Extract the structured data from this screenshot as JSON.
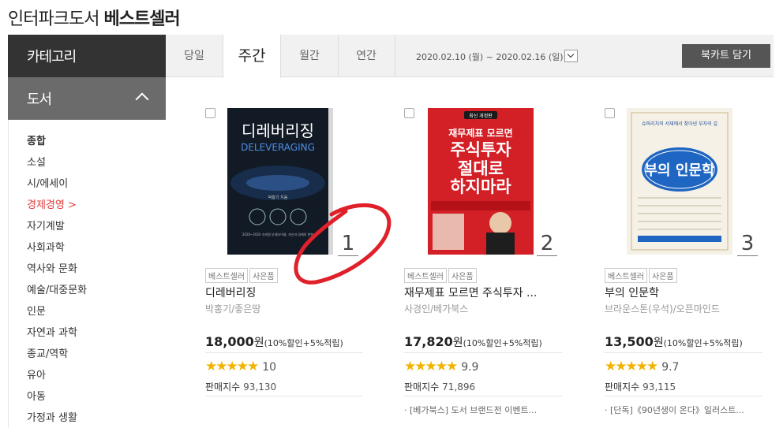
{
  "header": {
    "title_prefix": "인터파크도서",
    "title_main": "베스트셀러"
  },
  "sidebar": {
    "category_label": "카테고리",
    "section_label": "도서",
    "items": [
      {
        "label": "종합"
      },
      {
        "label": "소설"
      },
      {
        "label": "시/에세이"
      },
      {
        "label": "경제경영 >"
      },
      {
        "label": "자기계발"
      },
      {
        "label": "사회과학"
      },
      {
        "label": "역사와 문화"
      },
      {
        "label": "예술/대중문화"
      },
      {
        "label": "인문"
      },
      {
        "label": "자연과 과학"
      },
      {
        "label": "종교/역학"
      },
      {
        "label": "유아"
      },
      {
        "label": "아동"
      },
      {
        "label": "가정과 생활"
      }
    ]
  },
  "tabs": {
    "items": [
      {
        "label": "당일"
      },
      {
        "label": "주간"
      },
      {
        "label": "월간"
      },
      {
        "label": "연간"
      }
    ],
    "date_range": "2020.02.10 (월) ~ 2020.02.16 (일)",
    "cart_button": "북카트 담기"
  },
  "books": [
    {
      "rank": "1",
      "badges": [
        "베스트셀러",
        "사은품"
      ],
      "title": "디레버리징",
      "author": "박홍기/좋은땅",
      "price": "18,000",
      "won": "원",
      "discount": "(10%할인+5%적립)",
      "stars": "★★★★★",
      "score": "10",
      "sales_label": "판매지수",
      "sales_value": "93,130",
      "promo": "",
      "cover": {
        "title_ko": "디레버리징",
        "title_en": "DELEVERAGING",
        "author": "박홍기 지음",
        "years": "2020~2024 슈퍼원 부채사이클, 자산과 경제의 변화"
      }
    },
    {
      "rank": "2",
      "badges": [
        "베스트셀러",
        "사은품"
      ],
      "title": "재무제표 모르면 주식투자 ...",
      "author": "사경인/베가북스",
      "price": "17,820",
      "won": "원",
      "discount": "(10%할인+5%적립)",
      "stars": "★★★★★",
      "score": "9.9",
      "sales_label": "판매지수",
      "sales_value": "71,896",
      "promo": "· [베가북스] 도서 브랜드전 이벤트...",
      "cover": {
        "tag": "최신 개정판",
        "line1": "재무제표 모르면",
        "line2": "주식투자",
        "line3": "절대로",
        "line4": "하지마라"
      }
    },
    {
      "rank": "3",
      "badges": [
        "베스트셀러",
        "사은품"
      ],
      "title": "부의 인문학",
      "author": "브라운스톤(우석)/오픈마인드",
      "price": "13,500",
      "won": "원",
      "discount": "(10%할인+5%적립)",
      "stars": "★★★★★",
      "score": "9.7",
      "sales_label": "판매지수",
      "sales_value": "93,115",
      "promo": "· [단독]《90년생이 온다》일러스트...",
      "cover": {
        "top": "슈퍼리치의 서재에서 찾아낸 부자의 길",
        "title": "부의 인문학"
      }
    }
  ],
  "colors": {
    "accent_red": "#e23b3b",
    "star": "#f0b400",
    "sidebar_dark": "#333333",
    "sidebar_mid": "#6b6b6b"
  }
}
